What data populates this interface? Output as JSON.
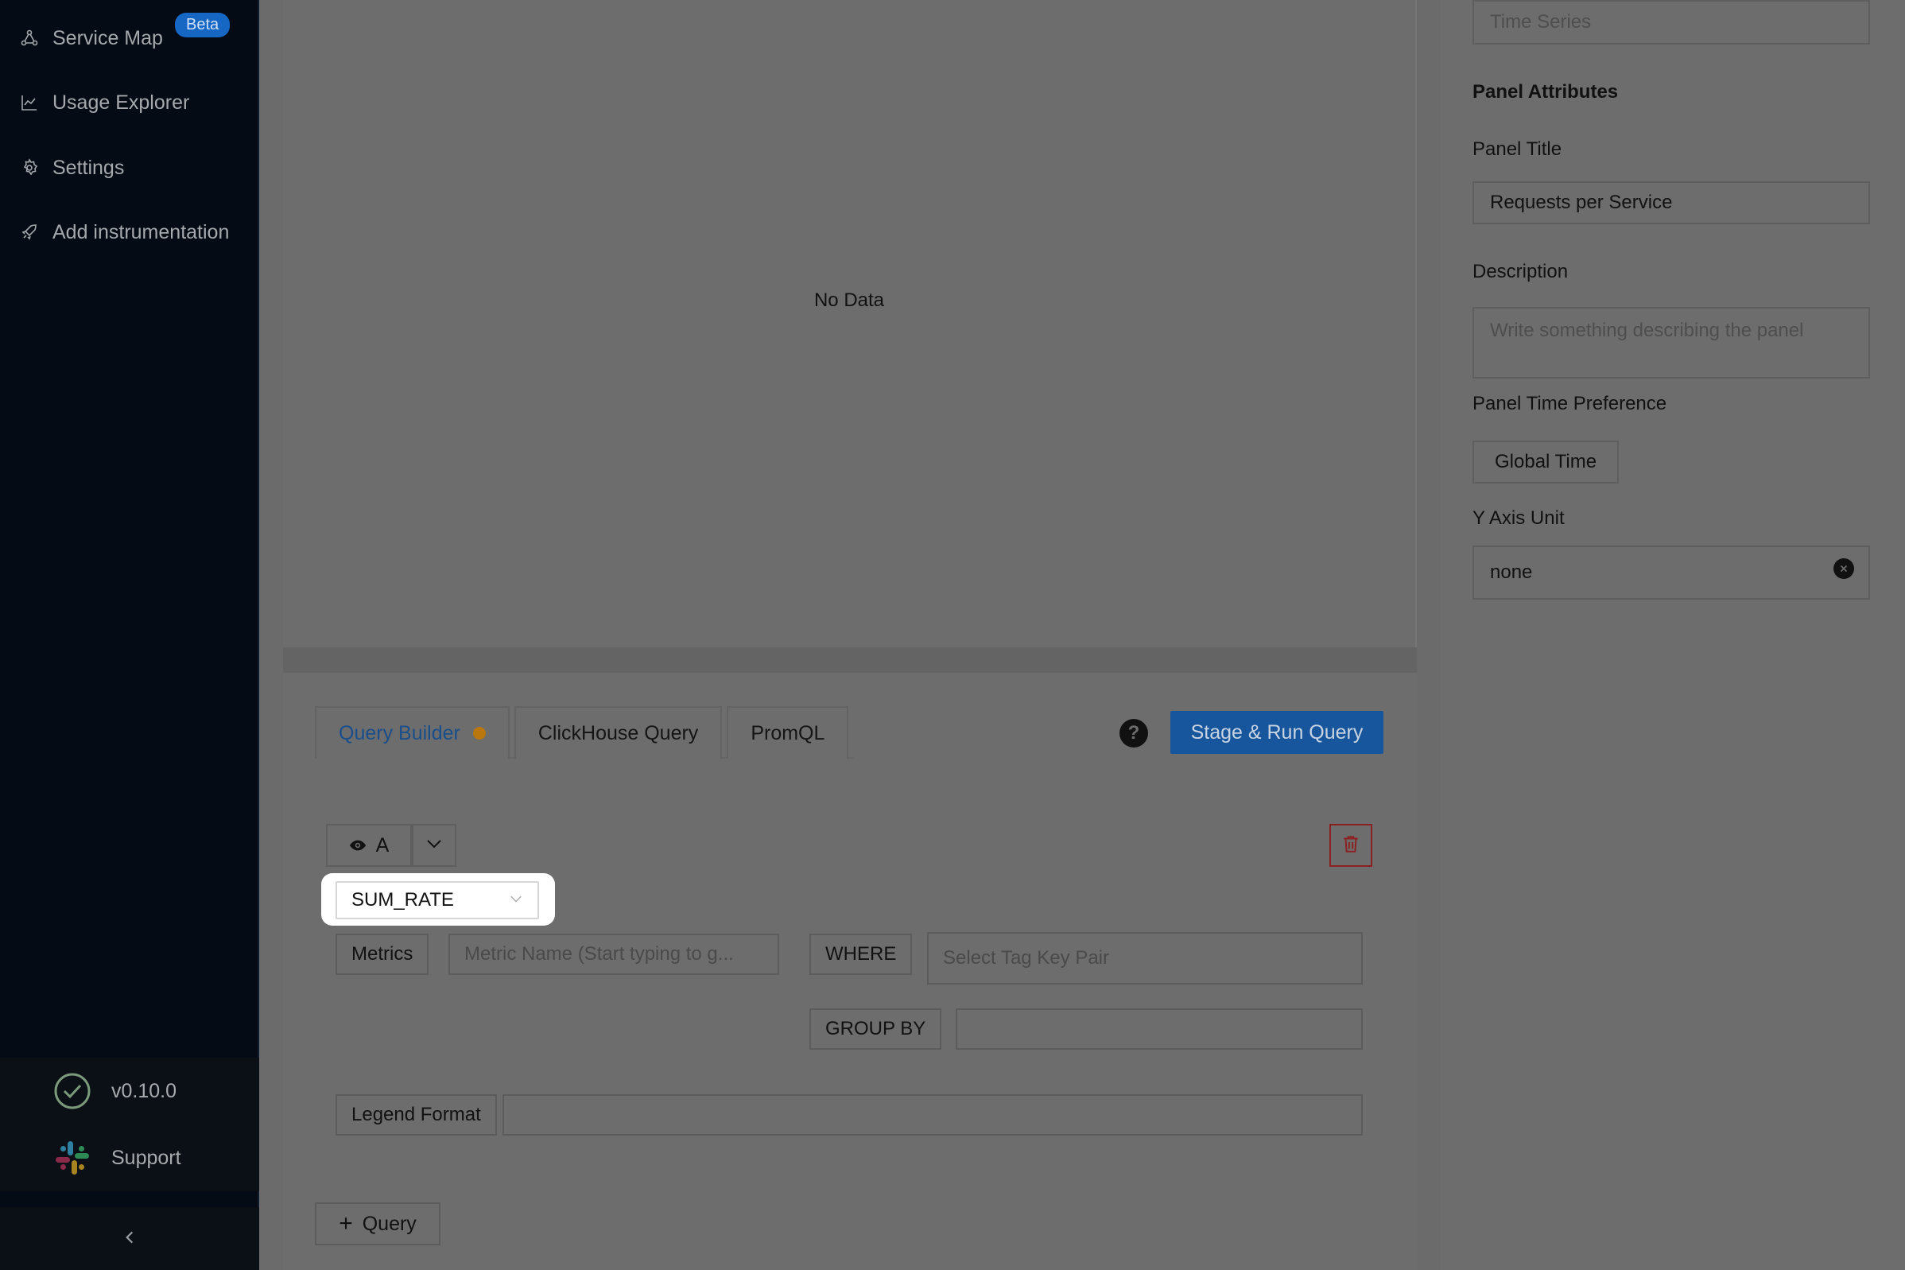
{
  "sidebar": {
    "items": [
      {
        "label": "Service Map",
        "icon": "service-map-icon",
        "badge": "Beta"
      },
      {
        "label": "Usage Explorer",
        "icon": "line-chart-icon"
      },
      {
        "label": "Settings",
        "icon": "gear-icon"
      },
      {
        "label": "Add instrumentation",
        "icon": "rocket-icon"
      }
    ],
    "version": "v0.10.0",
    "support": "Support",
    "collapse_icon": "chevron-left-icon"
  },
  "main": {
    "empty_message": "No Data"
  },
  "query": {
    "tabs": [
      {
        "label": "Query Builder",
        "active": true,
        "dirty": true
      },
      {
        "label": "ClickHouse Query"
      },
      {
        "label": "PromQL"
      }
    ],
    "help_label": "?",
    "run_button": "Stage & Run Query",
    "query_name": "A",
    "aggregation": "SUM_RATE",
    "metrics_label": "Metrics",
    "metrics_placeholder": "Metric Name (Start typing to g...",
    "where_label": "WHERE",
    "where_placeholder": "Select Tag Key Pair",
    "group_by_label": "GROUP BY",
    "legend_label": "Legend Format",
    "add_query_label": "Query"
  },
  "right": {
    "panel_type_placeholder": "Time Series",
    "attributes_heading": "Panel Attributes",
    "title_label": "Panel Title",
    "title_value": "Requests per Service",
    "description_label": "Description",
    "description_placeholder": "Write something describing the  panel",
    "time_pref_label": "Panel Time Preference",
    "time_pref_value": "Global Time",
    "y_axis_label": "Y Axis Unit",
    "y_axis_value": "none"
  },
  "colors": {
    "sidebar_bg": "#050b14",
    "accent": "#17569c",
    "dirty_dot": "#b9770e",
    "overlay": "#6d6d6d"
  }
}
